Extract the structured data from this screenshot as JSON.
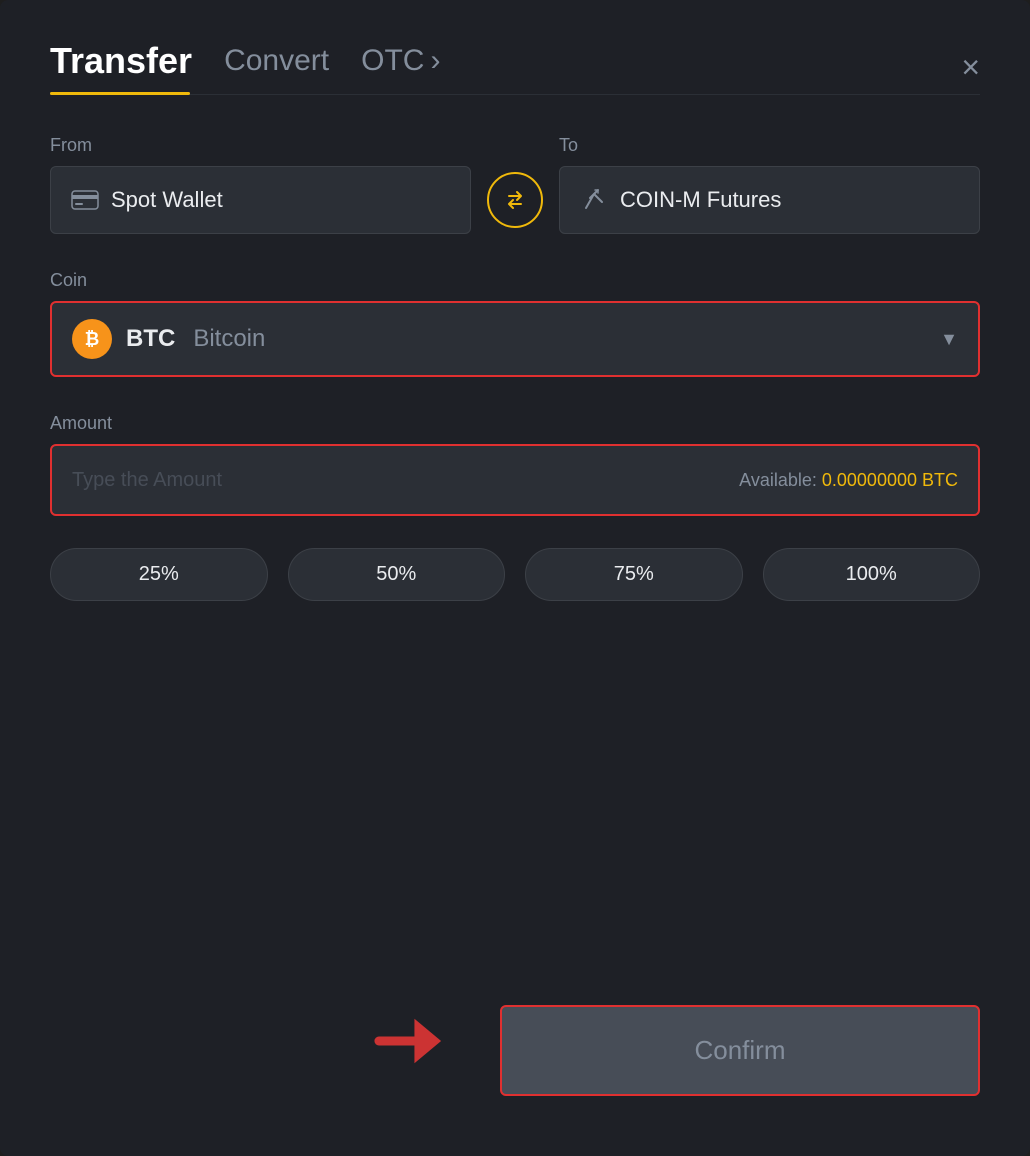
{
  "header": {
    "title_transfer": "Transfer",
    "title_convert": "Convert",
    "title_otc": "OTC",
    "otc_chevron": "›",
    "close_label": "×"
  },
  "tabs": {
    "active": "transfer"
  },
  "from_section": {
    "label": "From",
    "wallet_name": "Spot Wallet"
  },
  "to_section": {
    "label": "To",
    "wallet_name": "COIN-M Futures"
  },
  "coin_section": {
    "label": "Coin",
    "coin_symbol": "BTC",
    "coin_name": "Bitcoin",
    "chevron": "▼"
  },
  "amount_section": {
    "label": "Amount",
    "placeholder": "Type the Amount",
    "available_label": "Available:",
    "available_value": "0.00000000 BTC"
  },
  "percent_buttons": [
    "25%",
    "50%",
    "75%",
    "100%"
  ],
  "confirm_button": {
    "label": "Confirm"
  },
  "colors": {
    "accent": "#f0b90b",
    "danger": "#e03030",
    "bg_main": "#1e2026",
    "bg_input": "#2b2f36",
    "text_primary": "#eaecef",
    "text_muted": "#848e9c"
  }
}
